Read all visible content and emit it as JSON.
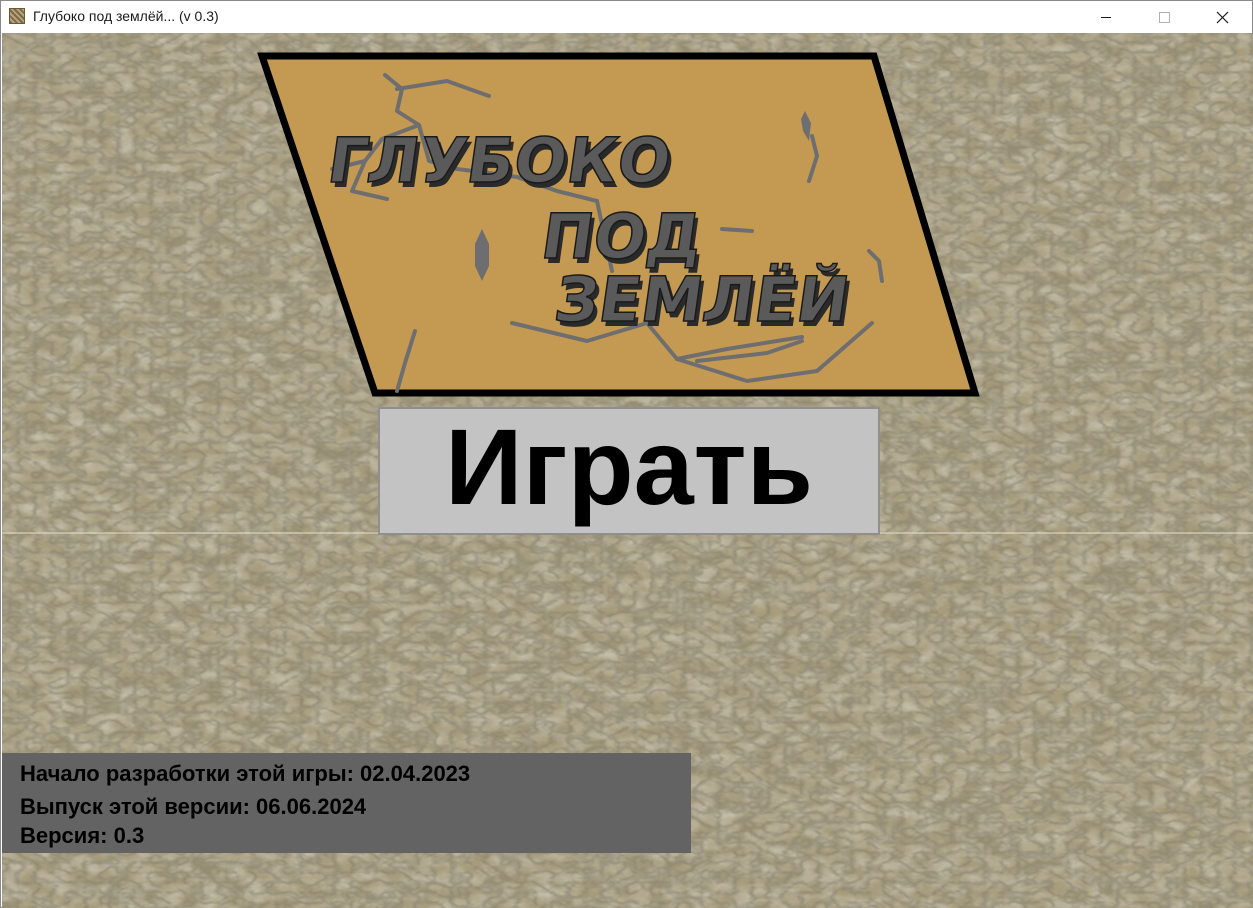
{
  "window": {
    "title": "Глубоко под землёй... (v 0.3)",
    "app_icon": "stone-texture-icon",
    "controls": [
      "minimize-icon",
      "maximize-icon",
      "close-icon"
    ]
  },
  "logo": {
    "line1": "ГЛУБОКО",
    "line2": "ПОД",
    "line3": "ЗЕМЛЁЙ",
    "panel_color": "#c49a52",
    "text_color": "#5a5a5a",
    "crack_color": "#6e6e70"
  },
  "menu": {
    "play_label": "Играть",
    "play_bg": "#c3c3c3"
  },
  "info": {
    "dev_start": "Начало разработки этой игры: 02.04.2023",
    "release": "Выпуск этой версии: 06.06.2024",
    "version": "Версия: 0.3",
    "panel_color": "#636363"
  },
  "colors": {
    "stone_light": "#b5ab8c",
    "stone_dark": "#6b6248"
  }
}
